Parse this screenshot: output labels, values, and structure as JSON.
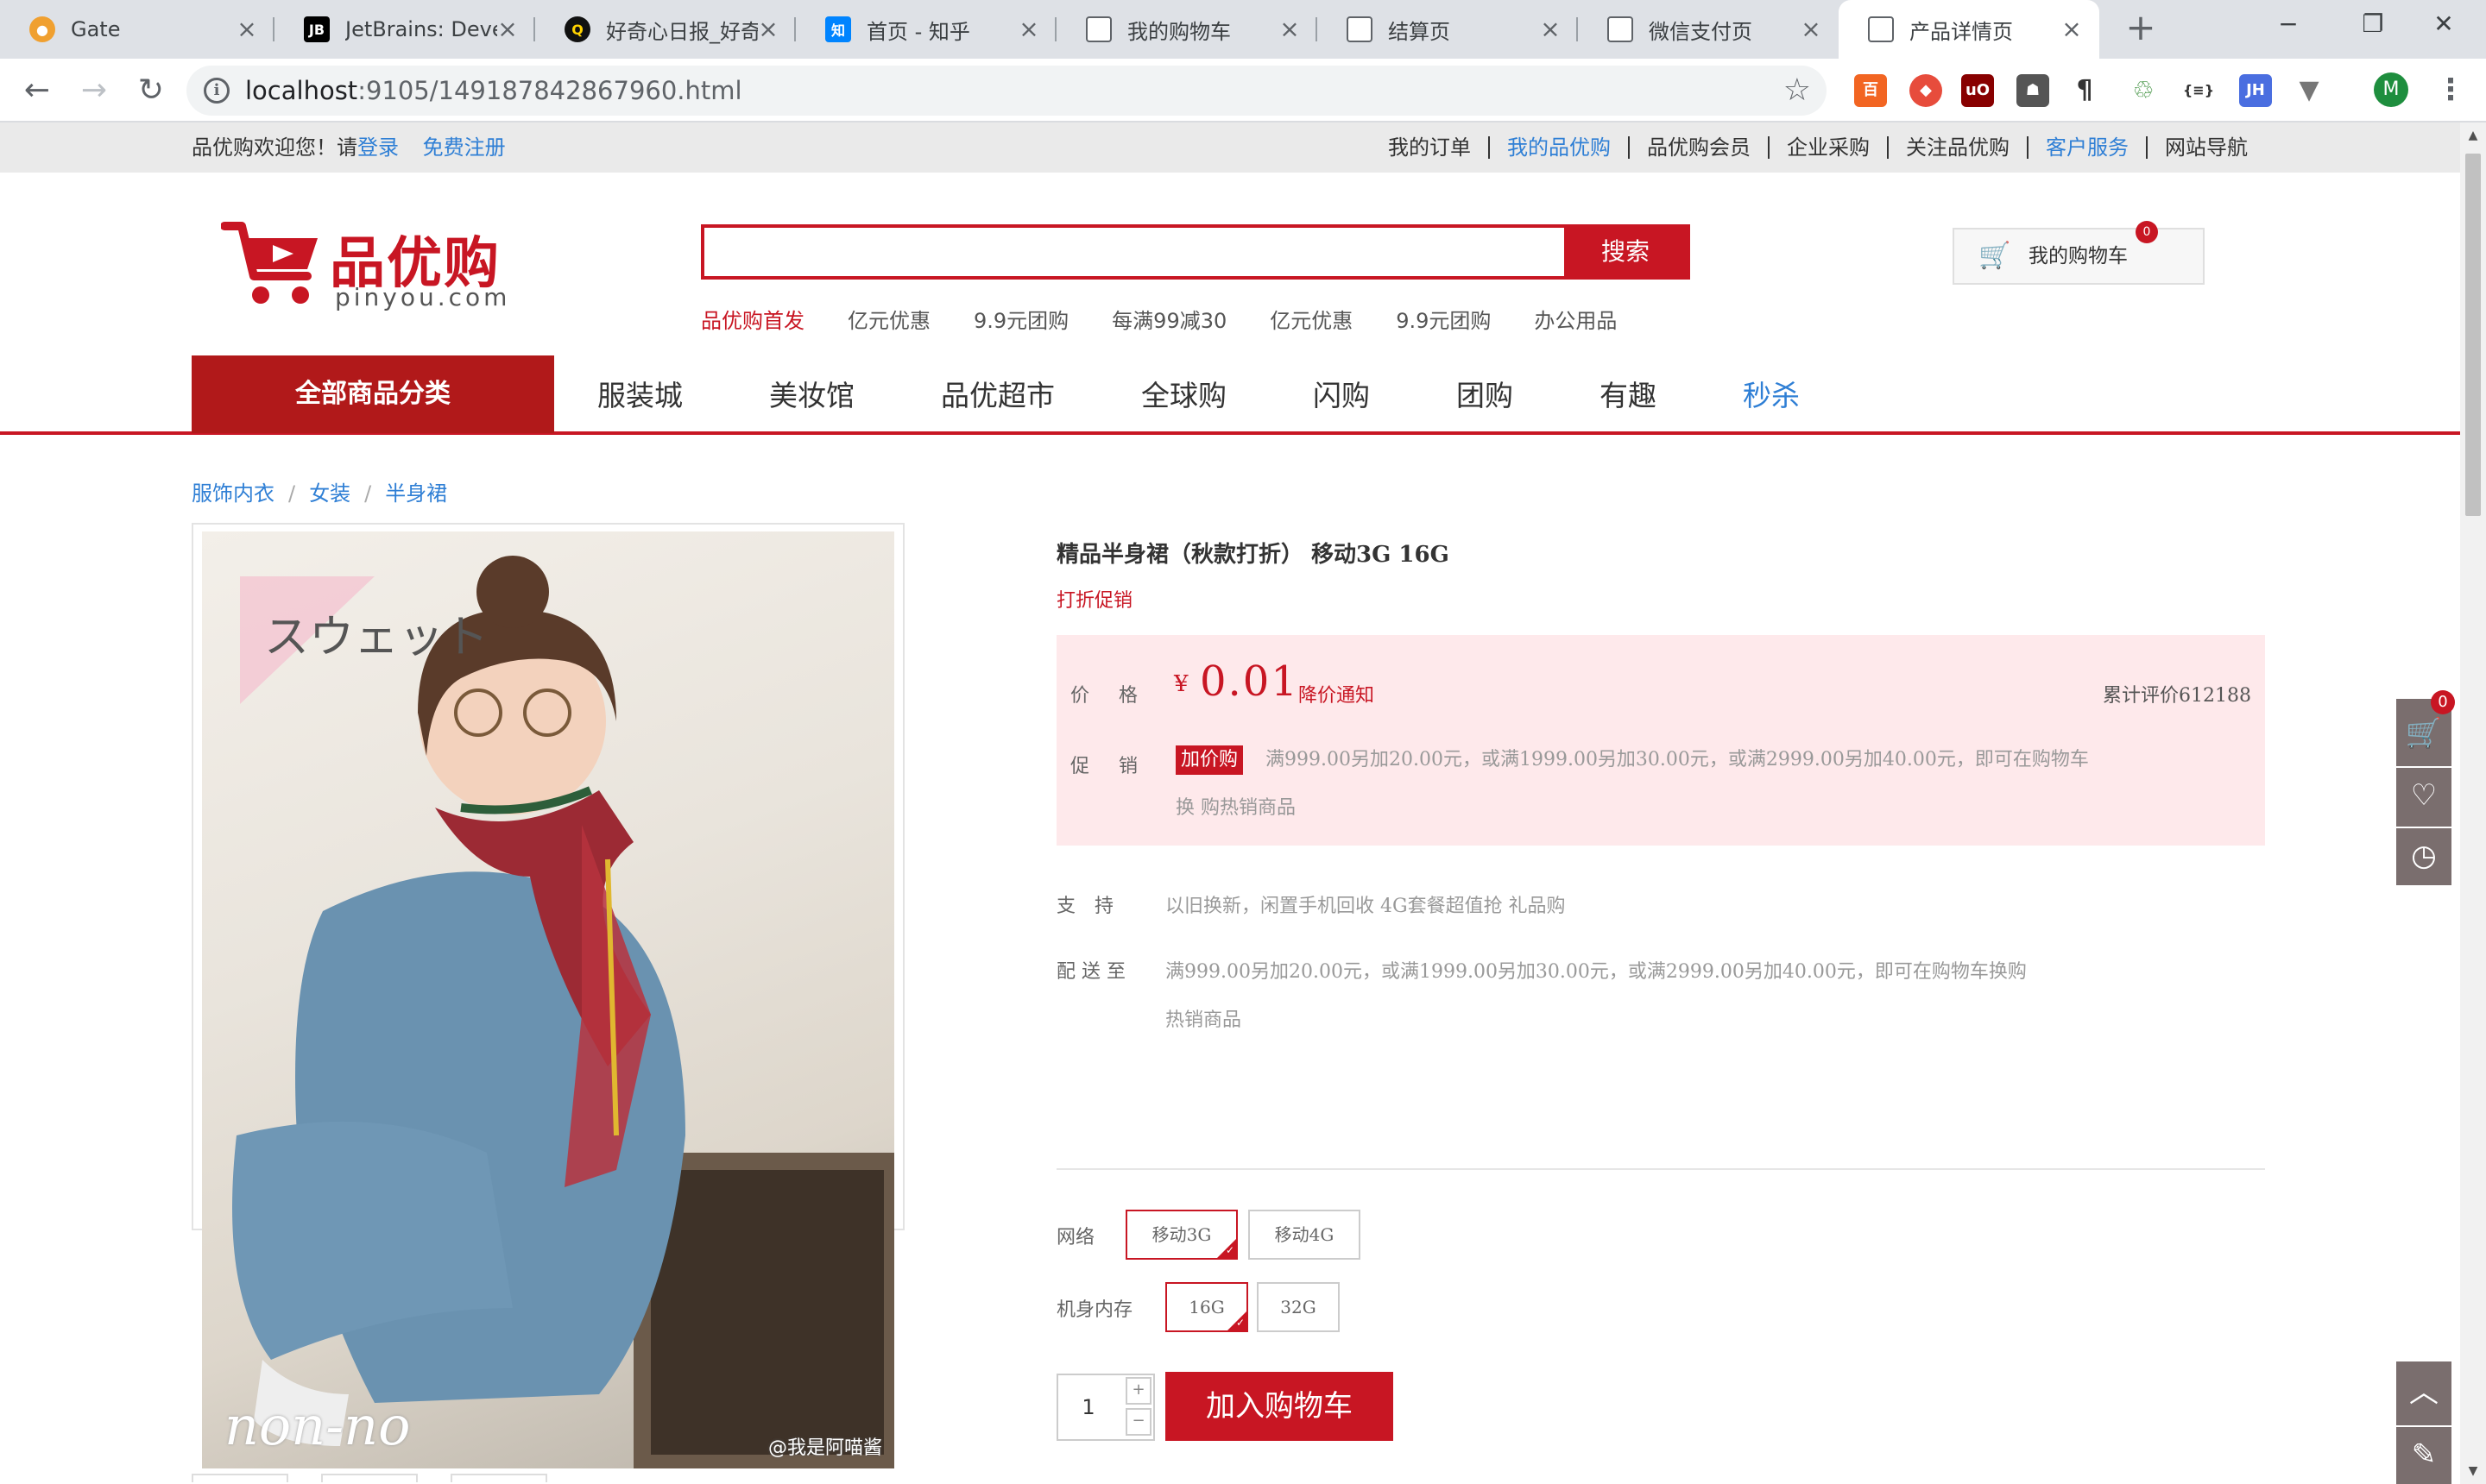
{
  "browser": {
    "tabs": [
      {
        "title": "Gate",
        "icon": "gate-icon",
        "color": "#e8711e"
      },
      {
        "title": "JetBrains: Deve",
        "icon": "jetbrains-icon",
        "color": "#000000"
      },
      {
        "title": "好奇心日报_好奇",
        "icon": "qdaily-icon",
        "color": "#111111"
      },
      {
        "title": "首页 - 知乎",
        "icon": "zhihu-icon",
        "color": "#0084ff"
      },
      {
        "title": "我的购物车",
        "icon": "page-icon",
        "color": "#ffffff"
      },
      {
        "title": "结算页",
        "icon": "page-icon",
        "color": "#ffffff"
      },
      {
        "title": "微信支付页",
        "icon": "page-icon",
        "color": "#ffffff"
      },
      {
        "title": "产品详情页",
        "icon": "page-icon",
        "color": "#ffffff"
      }
    ],
    "url_host": "localhost",
    "url_rest": ":9105/149187842867960.html",
    "profile_initial": "M"
  },
  "topnav": {
    "welcome": "品优购欢迎您！请",
    "login": "登录",
    "register": "免费注册",
    "links": [
      "我的订单",
      "我的品优购",
      "品优购会员",
      "企业采购",
      "关注品优购",
      "客户服务",
      "网站导航"
    ]
  },
  "logo": {
    "name": "品优购",
    "domain": "pinyou.com"
  },
  "search": {
    "value": "",
    "button": "搜索"
  },
  "hotwords": [
    "品优购首发",
    "亿元优惠",
    "9.9元团购",
    "每满99减30",
    "亿元优惠",
    "9.9元团购",
    "办公用品"
  ],
  "cart": {
    "label": "我的购物车",
    "count": "0"
  },
  "catnav": {
    "all": "全部商品分类",
    "items": [
      "服装城",
      "美妆馆",
      "品优超市",
      "全球购",
      "闪购",
      "团购",
      "有趣",
      "秒杀"
    ]
  },
  "breadcrumb": [
    "服饰内衣",
    "女装",
    "半身裙"
  ],
  "photo": {
    "watermark": "スウェット",
    "brand": "non-no",
    "weibo": "@我是阿喵酱"
  },
  "product": {
    "title": "精品半身裙（秋款打折） 移动3G 16G",
    "promo": "打折促销",
    "price_label": "价格",
    "currency": "¥",
    "price": "0.01",
    "price_notice": "降价通知",
    "eval": "累计评价612188",
    "promotion_label": "促销",
    "promotion_tag": "加价购",
    "promotion_text": "满999.00另加20.00元，或满1999.00另加30.00元，或满2999.00另加40.00元，即可在购物车换 购热销商品",
    "support_label": "支　持",
    "support_text": "以旧换新，闲置手机回收 4G套餐超值抢 礼品购",
    "delivery_label": "配 送 至",
    "delivery_line1": "满999.00另加20.00元，或满1999.00另加30.00元，或满2999.00另加40.00元，即可在购物车换购",
    "delivery_line2": "热销商品",
    "network_label": "网络",
    "network_options": [
      "移动3G",
      "移动4G"
    ],
    "memory_label": "机身内存",
    "memory_options": [
      "16G",
      "32G"
    ],
    "quantity": "1",
    "add_to_cart": "加入购物车"
  },
  "sidetool": {
    "cart_count": "0"
  }
}
